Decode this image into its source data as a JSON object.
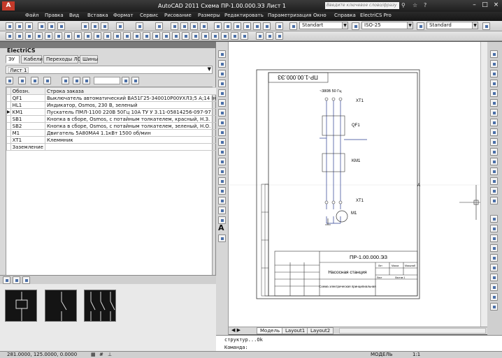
{
  "window": {
    "title": "AutoCAD 2011   Схема ПР-1.00.000.ЭЗ Лист 1",
    "search_placeholder": "Введите ключевое слово/фразу"
  },
  "menu": [
    "Файл",
    "Правка",
    "Вид",
    "Вставка",
    "Формат",
    "Сервис",
    "Рисование",
    "Размеры",
    "Редактировать",
    "Параметризация",
    "Окно",
    "Справка",
    "ElectriCS Pro"
  ],
  "toolbar": {
    "style1": "Standart",
    "style2": "ISO-25",
    "style3": "Standard"
  },
  "panel": {
    "name": "ElectriCS",
    "tabs": [
      "ЭУ",
      "Кабели",
      "Переходы ЛС",
      "Шины"
    ],
    "sheet": "Лист 1",
    "columns": [
      "Обозн.",
      "Строка заказа"
    ],
    "rows": [
      {
        "id": "QF1",
        "desc": "Выключатель автоматический ВА51Г25-340010Р00УХЛ3;5 А;14 Iн ТУ 16-522.157-83"
      },
      {
        "id": "HL1",
        "desc": "Индикатор, Osmos, 230 В, зеленый"
      },
      {
        "id": "KM1",
        "desc": "Пускатель ПМЛ-1100 220В 50Гц 10А ТУ У 3.11-05814256-097-97"
      },
      {
        "id": "SB1",
        "desc": "Кнопка в сборе, Osmos, с потайным толкателем, красный, Н.З."
      },
      {
        "id": "SB2",
        "desc": "Кнопка в сборе, Osmos, с потайным толкателем, зеленый, Н.О."
      },
      {
        "id": "M1",
        "desc": "Двигатель 5А80МА4 1.1кВт 1500 об/мин"
      },
      {
        "id": "XT1",
        "desc": "Клеммник"
      },
      {
        "id": "Заземление",
        "desc": ""
      }
    ]
  },
  "drawing": {
    "stamp_rot": "ПР-1.00.000.ЭЗ",
    "supply": "~380В 50 Гц",
    "labels": {
      "xt1a": "XT1",
      "qf1": "QF1",
      "km1": "KM1",
      "xt1b": "XT1",
      "m1": "M1",
      "a": "A"
    },
    "title_code": "ПР-1.00.000.ЭЗ",
    "title_name": "Насосная станция",
    "title_doc": "Схема электрическая принципиальная",
    "lit": "Лит",
    "mass": "Масса",
    "scale": "Масштаб",
    "sheet": "Лист",
    "sheets": "Листов 1"
  },
  "layouts": [
    "Модель",
    "Layout1",
    "Layout2"
  ],
  "command": {
    "line1": "структур...Ok",
    "line2": "Команда:"
  },
  "status": {
    "coords": "281.0000, 125.0000, 0.0000",
    "mode": "МОДЕЛЬ",
    "scale": "1:1"
  }
}
